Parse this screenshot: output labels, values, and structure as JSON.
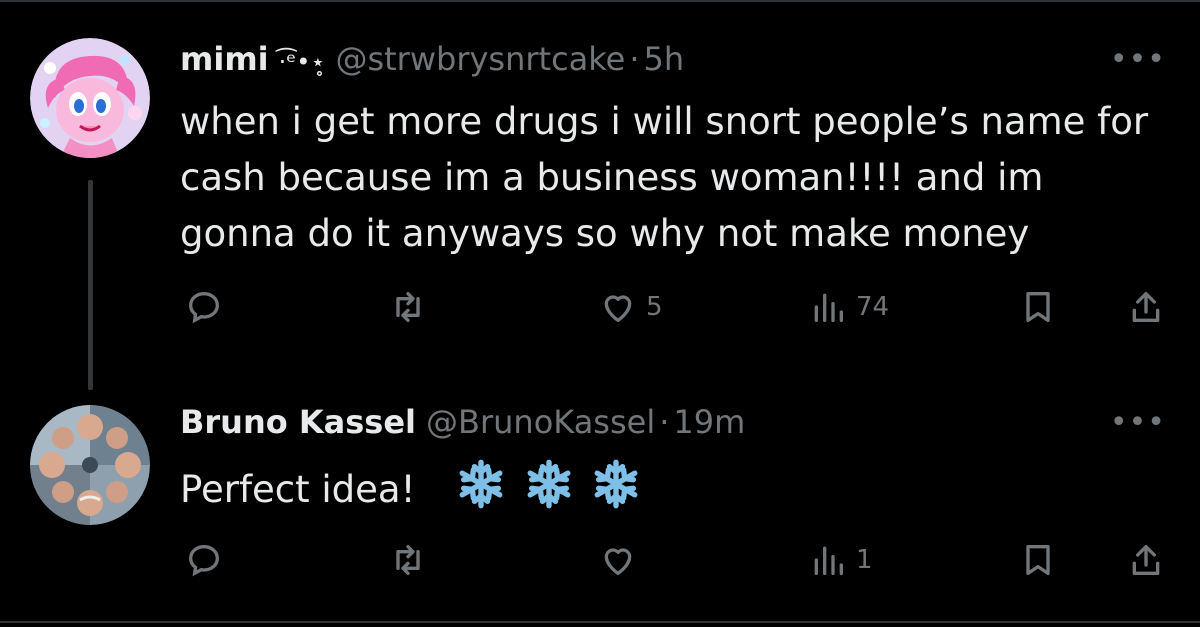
{
  "tweets": [
    {
      "name": "mimi",
      "name_deco": "·͡ᵉ•⋆̥",
      "handle": "@strwbrysnrtcake",
      "separator": "·",
      "time": "5h",
      "text": "when i get more drugs i will snort people’s name for cash because im a business woman!!!! and im gonna do it anyways so why not make money",
      "likes": "5",
      "views": "74",
      "more": "•••"
    },
    {
      "name": "Bruno Kassel",
      "handle": "@BrunoKassel",
      "separator": "·",
      "time": "19m",
      "text": "Perfect idea!",
      "likes": "",
      "views": "1",
      "more": "•••",
      "emoji_icons": [
        "snowflake-icon",
        "snowflake-icon",
        "snowflake-icon"
      ]
    }
  ],
  "colors": {
    "background": "#000000",
    "text": "#e7e9ea",
    "secondary": "#71767b",
    "snowflake": "#7dbfe6"
  }
}
